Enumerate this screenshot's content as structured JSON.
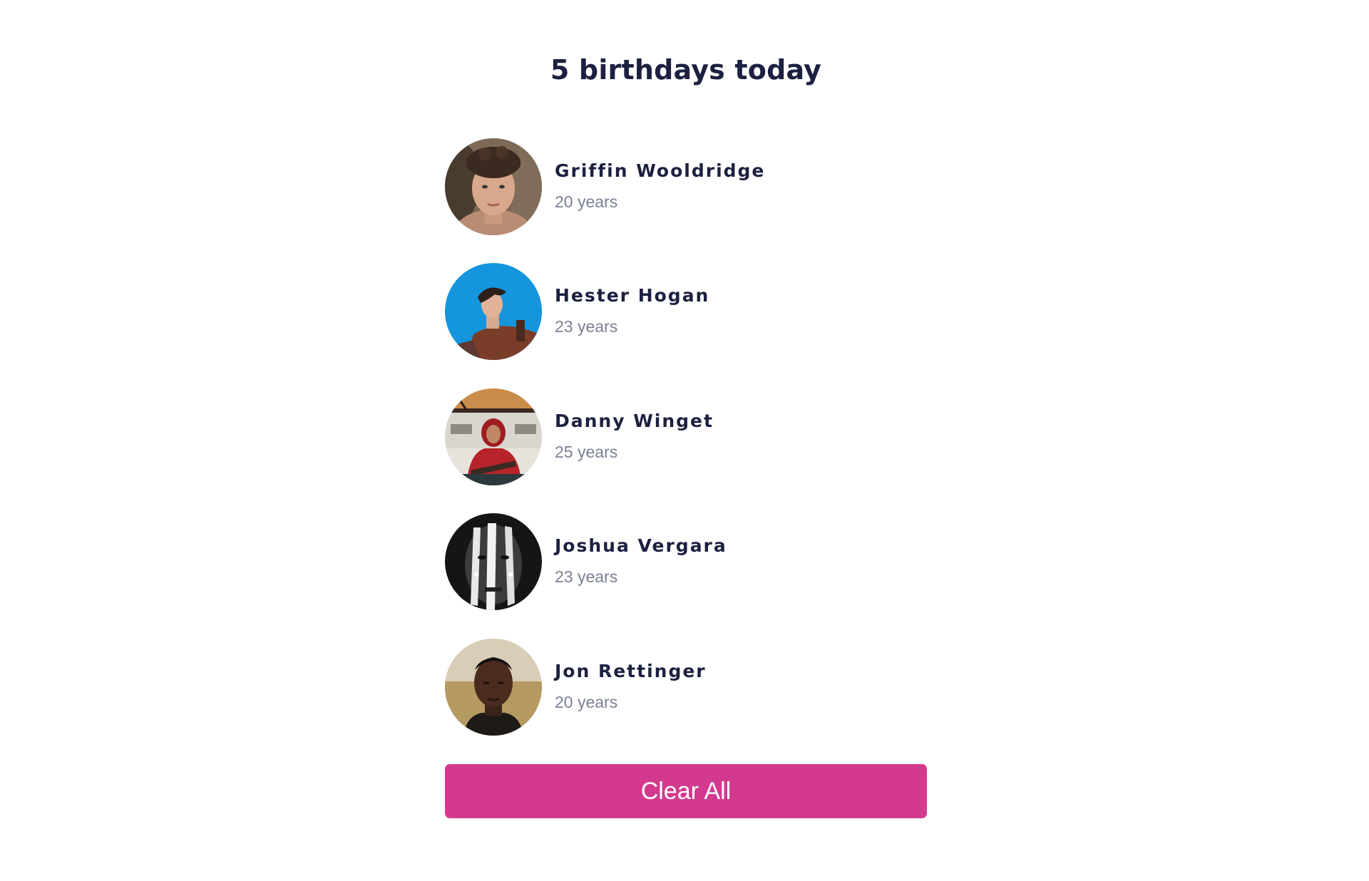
{
  "header": {
    "title": "5 birthdays today"
  },
  "people": [
    {
      "name": "Griffin Wooldridge",
      "age": "20 years",
      "avatar": "portrait-curly-hair"
    },
    {
      "name": "Hester Hogan",
      "age": "23 years",
      "avatar": "portrait-blue-sky"
    },
    {
      "name": "Danny Winget",
      "age": "25 years",
      "avatar": "portrait-red-hoodie"
    },
    {
      "name": "Joshua Vergara",
      "age": "23 years",
      "avatar": "portrait-face-paint"
    },
    {
      "name": "Jon Rettinger",
      "age": "20 years",
      "avatar": "portrait-field"
    }
  ],
  "actions": {
    "clear_label": "Clear All"
  },
  "colors": {
    "accent": "#d33a8f",
    "heading": "#1c2040",
    "muted": "#7b8094",
    "background": "#ffffff"
  }
}
